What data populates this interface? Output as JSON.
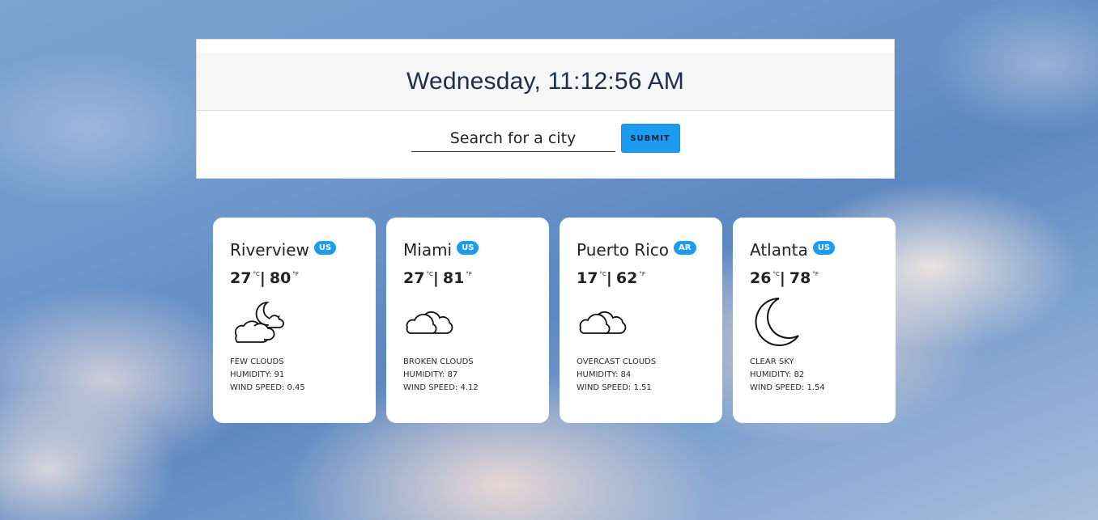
{
  "header": {
    "clock": "Wednesday, 11:12:56 AM"
  },
  "search": {
    "placeholder": "Search for a city",
    "value": "",
    "submit_label": "SUBMIT"
  },
  "colors": {
    "accent": "#1d9bf0",
    "card_bg": "#ffffff"
  },
  "cards": [
    {
      "city": "Riverview",
      "country": "US",
      "temp_c": "27",
      "unit_c": "°C",
      "separator": "|",
      "temp_f": "80",
      "unit_f": "°F",
      "icon": "few-clouds-night-icon",
      "description": "FEW CLOUDS",
      "humidity": "HUMIDITY: 91",
      "wind": "WIND SPEED: 0.45"
    },
    {
      "city": "Miami",
      "country": "US",
      "temp_c": "27",
      "unit_c": "°C",
      "separator": "|",
      "temp_f": "81",
      "unit_f": "°F",
      "icon": "broken-clouds-icon",
      "description": "BROKEN CLOUDS",
      "humidity": "HUMIDITY: 87",
      "wind": "WIND SPEED: 4.12"
    },
    {
      "city": "Puerto Rico",
      "country": "AR",
      "temp_c": "17",
      "unit_c": "°C",
      "separator": "|",
      "temp_f": "62",
      "unit_f": "°F",
      "icon": "overcast-clouds-icon",
      "description": "OVERCAST CLOUDS",
      "humidity": "HUMIDITY: 84",
      "wind": "WIND SPEED: 1.51"
    },
    {
      "city": "Atlanta",
      "country": "US",
      "temp_c": "26",
      "unit_c": "°C",
      "separator": "|",
      "temp_f": "78",
      "unit_f": "°F",
      "icon": "clear-sky-night-icon",
      "description": "CLEAR SKY",
      "humidity": "HUMIDITY: 82",
      "wind": "WIND SPEED: 1.54"
    }
  ]
}
